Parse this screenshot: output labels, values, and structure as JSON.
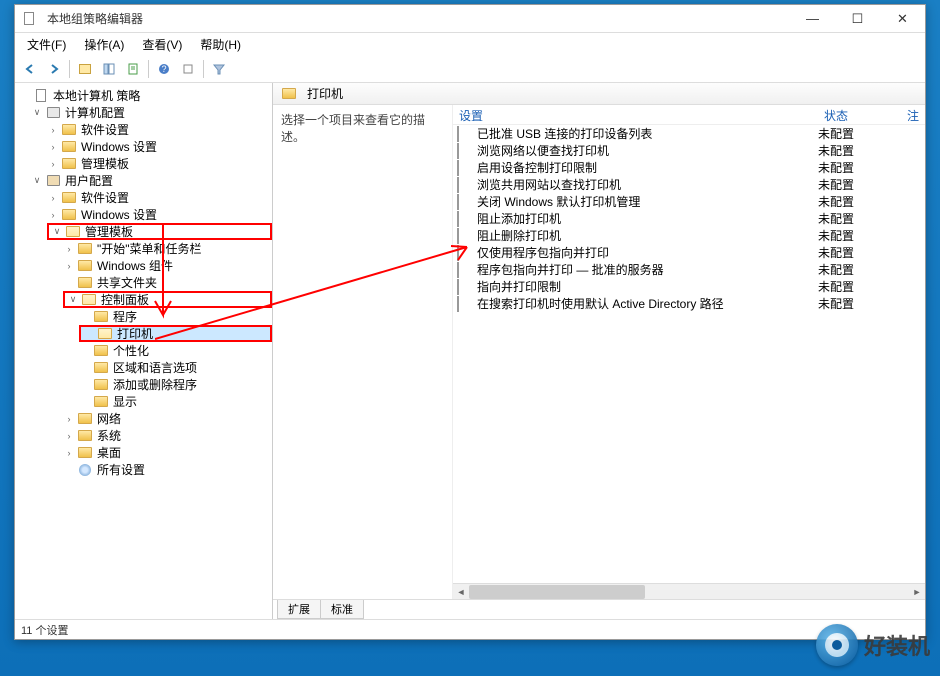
{
  "window": {
    "title": "本地组策略编辑器"
  },
  "menubar": {
    "file": "文件(F)",
    "action": "操作(A)",
    "view": "查看(V)",
    "help": "帮助(H)"
  },
  "tree": {
    "root": "本地计算机 策略",
    "computer_config": "计算机配置",
    "software_settings_1": "软件设置",
    "windows_settings_1": "Windows 设置",
    "admin_templates_1": "管理模板",
    "user_config": "用户配置",
    "software_settings_2": "软件设置",
    "windows_settings_2": "Windows 设置",
    "admin_templates_2": "管理模板",
    "start_taskbar": "\"开始\"菜单和任务栏",
    "windows_components": "Windows 组件",
    "shared_folders": "共享文件夹",
    "control_panel": "控制面板",
    "programs": "程序",
    "printers": "打印机",
    "personalization": "个性化",
    "region_lang": "区域和语言选项",
    "add_remove": "添加或删除程序",
    "display": "显示",
    "network": "网络",
    "system": "系统",
    "desktop": "桌面",
    "all_settings": "所有设置"
  },
  "right": {
    "header_title": "打印机",
    "description": "选择一个项目来查看它的描述。",
    "columns": {
      "setting": "设置",
      "status": "状态",
      "note": "注"
    },
    "settings": [
      {
        "name": "已批准 USB 连接的打印设备列表",
        "status": "未配置"
      },
      {
        "name": "浏览网络以便查找打印机",
        "status": "未配置"
      },
      {
        "name": "启用设备控制打印限制",
        "status": "未配置"
      },
      {
        "name": "浏览共用网站以查找打印机",
        "status": "未配置"
      },
      {
        "name": "关闭 Windows 默认打印机管理",
        "status": "未配置"
      },
      {
        "name": "阻止添加打印机",
        "status": "未配置"
      },
      {
        "name": "阻止删除打印机",
        "status": "未配置"
      },
      {
        "name": "仅使用程序包指向并打印",
        "status": "未配置"
      },
      {
        "name": "程序包指向并打印 — 批准的服务器",
        "status": "未配置"
      },
      {
        "name": "指向并打印限制",
        "status": "未配置"
      },
      {
        "name": "在搜索打印机时使用默认 Active Directory 路径",
        "status": "未配置"
      }
    ],
    "tabs": {
      "extended": "扩展",
      "standard": "标准"
    }
  },
  "statusbar": {
    "text": "11 个设置"
  },
  "watermark": {
    "text": "好装机"
  }
}
